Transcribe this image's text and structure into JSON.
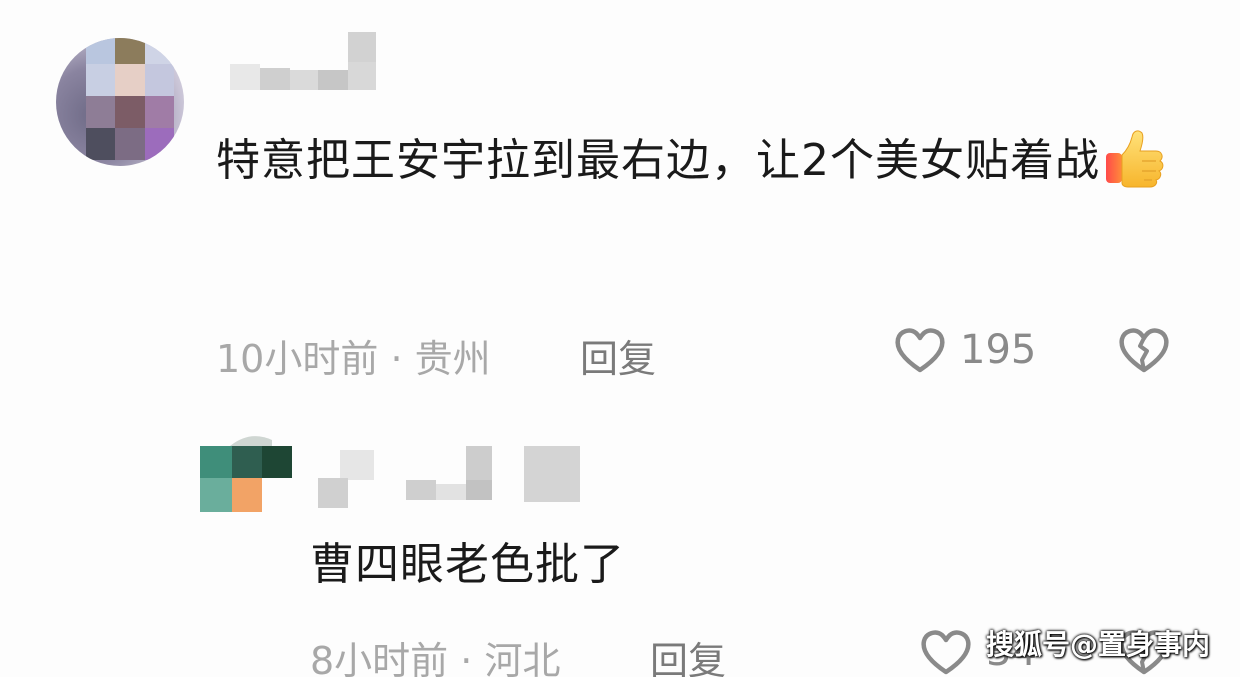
{
  "comments": [
    {
      "avatar_colors": [
        "#b9c6df",
        "#8c7c5c",
        "#cfd4e6",
        "#c8cfe3",
        "#e6cfc6",
        "#c4c7de",
        "#8e7d96",
        "#7c5c66",
        "#a07ca6",
        "#4e4e5e",
        "#7c6c84",
        "#9c6cbc"
      ],
      "text": "特意把王安宇拉到最右边，让2个美女贴着战",
      "time": "10小时前",
      "separator": "·",
      "location": "贵州",
      "reply_label": "回复",
      "like_count": "195"
    },
    {
      "avatar_colors": [
        "#3f8e7a",
        "#2f5e50",
        "#1e4634",
        "#6aae9c",
        "#f2a366",
        "#f1f1f1"
      ],
      "text": "曹四眼老色批了",
      "time": "8小时前",
      "separator": "·",
      "location": "河北",
      "reply_label": "回复",
      "like_count": "34"
    }
  ],
  "watermark": "搜狐号@置身事内",
  "icons": {
    "like": "heart-outline-icon",
    "dislike": "broken-heart-icon",
    "thumbs_up": "thumbs-up-emoji"
  },
  "colors": {
    "text": "#1a1a1a",
    "meta": "#a8a8a8",
    "reply": "#7a7a7a",
    "icon": "#8a8a8a"
  }
}
